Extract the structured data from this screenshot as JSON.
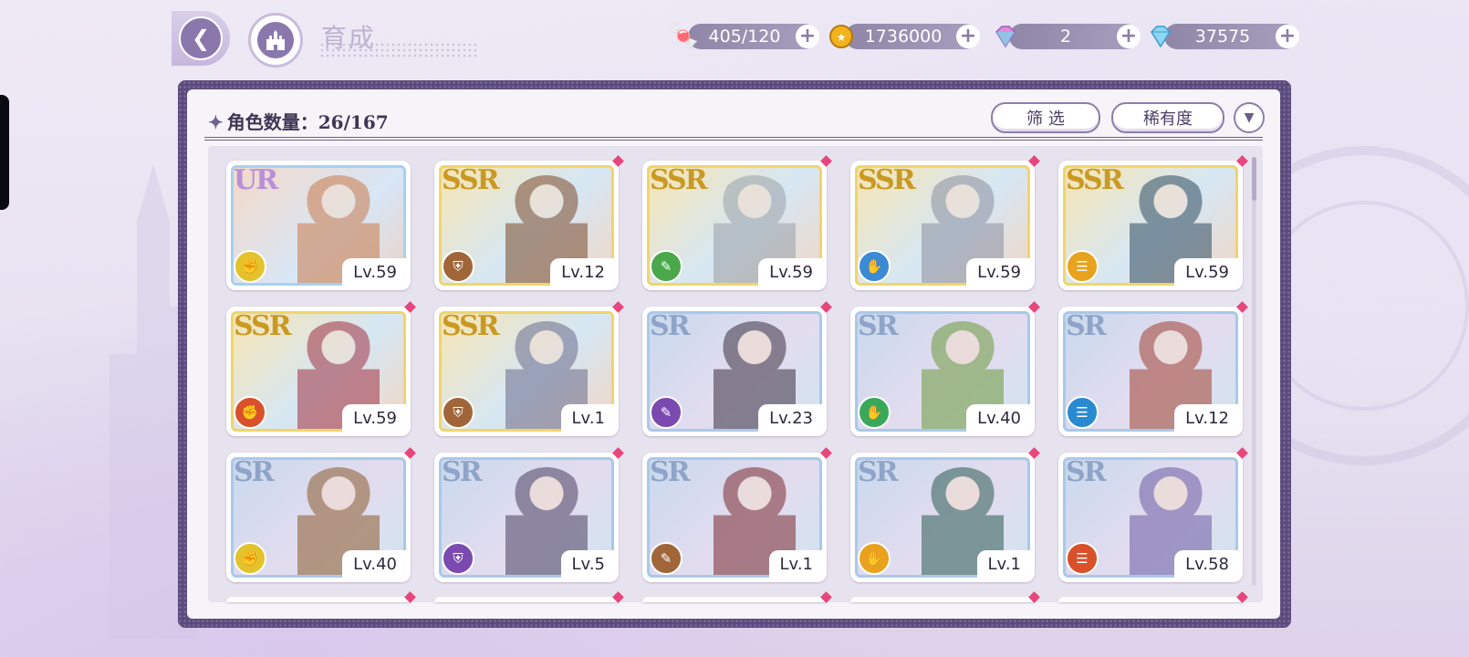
{
  "header": {
    "title": "育成"
  },
  "currencies": [
    {
      "name": "stamina",
      "value": "405/120",
      "icon": "candy-icon"
    },
    {
      "name": "gold",
      "value": "1736000",
      "icon": "coin-icon"
    },
    {
      "name": "paid-gem",
      "value": "2",
      "icon": "rainbow-gem-icon"
    },
    {
      "name": "gem",
      "value": "37575",
      "icon": "diamond-icon"
    }
  ],
  "panel": {
    "count_label": "角色数量：26/167",
    "filter_label": "筛 选",
    "sort_label": "稀有度"
  },
  "characters": [
    {
      "rarity": "UR",
      "level": "Lv.59",
      "class_color": "#e3c22c",
      "tint": "#c97a4a"
    },
    {
      "rarity": "SSR",
      "level": "Lv.12",
      "class_color": "#a0663a",
      "tint": "#7a4a2a"
    },
    {
      "rarity": "SSR",
      "level": "Lv.59",
      "class_color": "#4aa84a",
      "tint": "#9aa0a6"
    },
    {
      "rarity": "SSR",
      "level": "Lv.59",
      "class_color": "#3a8ad6",
      "tint": "#8b8e9e"
    },
    {
      "rarity": "SSR",
      "level": "Lv.59",
      "class_color": "#e8a21e",
      "tint": "#2e4a5e"
    },
    {
      "rarity": "SSR",
      "level": "Lv.59",
      "class_color": "#d9502a",
      "tint": "#a03040"
    },
    {
      "rarity": "SSR",
      "level": "Lv.1",
      "class_color": "#a0663a",
      "tint": "#6a6a8a"
    },
    {
      "rarity": "SR",
      "level": "Lv.23",
      "class_color": "#7a4ab0",
      "tint": "#3a3040"
    },
    {
      "rarity": "SR",
      "level": "Lv.40",
      "class_color": "#3aa85a",
      "tint": "#6a9a3a"
    },
    {
      "rarity": "SR",
      "level": "Lv.12",
      "class_color": "#2a8ad0",
      "tint": "#a04030"
    },
    {
      "rarity": "SR",
      "level": "Lv.40",
      "class_color": "#e3c22c",
      "tint": "#8a5a2a"
    },
    {
      "rarity": "SR",
      "level": "Lv.5",
      "class_color": "#7a4ab0",
      "tint": "#4a4060"
    },
    {
      "rarity": "SR",
      "level": "Lv.1",
      "class_color": "#a0663a",
      "tint": "#7a2a30"
    },
    {
      "rarity": "SR",
      "level": "Lv.1",
      "class_color": "#e8a21e",
      "tint": "#2a5a50"
    },
    {
      "rarity": "SR",
      "level": "Lv.58",
      "class_color": "#d9502a",
      "tint": "#6a5aa0"
    }
  ],
  "colors": {
    "frame": "#5b4b7c",
    "accent": "#8a78ad",
    "gem_marker": "#e8457c"
  }
}
